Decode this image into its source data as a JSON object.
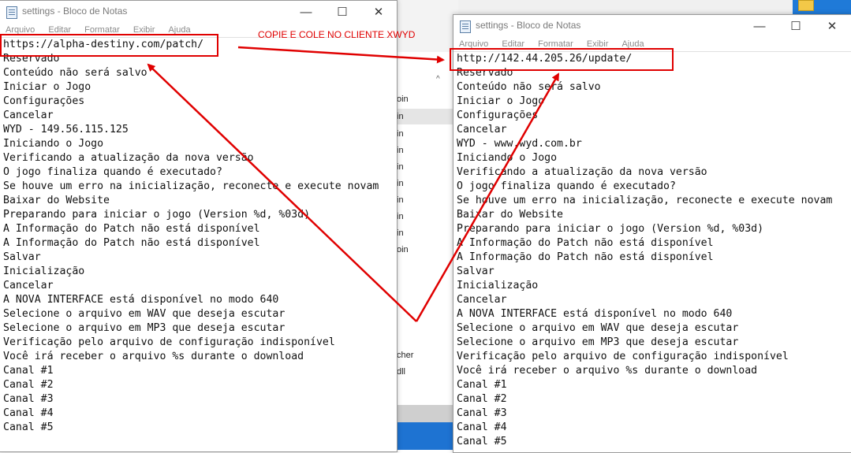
{
  "colors": {
    "annotation": "#e00000",
    "text": "#111111",
    "title_text": "#7a7a7a"
  },
  "background": {
    "explorer_rows": [
      "oin",
      "in",
      "in",
      "in",
      "in",
      "in",
      "in",
      "in",
      "in",
      "oin",
      "cher",
      "dll"
    ]
  },
  "annotation": {
    "label": "COPIE E COLE NO CLIENTE XWYD"
  },
  "left_window": {
    "title": "settings - Bloco de Notas",
    "menu": [
      "Arquivo",
      "Editar",
      "Formatar",
      "Exibir",
      "Ajuda"
    ],
    "buttons": {
      "minimize": "—",
      "maximize": "☐",
      "close": "✕"
    },
    "lines": [
      "https://alpha-destiny.com/patch/",
      "Reservado",
      "Conteúdo não será salvo",
      "Iniciar o Jogo",
      "Configurações",
      "Cancelar",
      "WYD - 149.56.115.125",
      "Iniciando o Jogo",
      "Verificando a atualização da nova versão",
      "O jogo finaliza quando é executado?",
      "Se houve um erro na inicialização, reconecte e execute novam",
      "Baixar do Website",
      "Preparando para iniciar o jogo (Version %d, %03d)",
      "A Informação do Patch não está disponível",
      "A Informação do Patch não está disponível",
      "Salvar",
      "Inicialização",
      "Cancelar",
      "A NOVA INTERFACE está disponível no modo 640",
      "Selecione o arquivo em WAV que deseja escutar",
      "Selecione o arquivo em MP3 que deseja escutar",
      "Verificação pelo arquivo de configuração indisponível",
      "Você irá receber o arquivo %s durante o download",
      "Canal #1",
      "Canal #2",
      "Canal #3",
      "Canal #4",
      "Canal #5"
    ]
  },
  "right_window": {
    "title": "settings - Bloco de Notas",
    "menu": [
      "Arquivo",
      "Editar",
      "Formatar",
      "Exibir",
      "Ajuda"
    ],
    "buttons": {
      "minimize": "—",
      "maximize": "☐",
      "close": "✕"
    },
    "lines": [
      "http://142.44.205.26/update/",
      "Reservado",
      "Conteúdo não será salvo",
      "Iniciar o Jogo",
      "Configurações",
      "Cancelar",
      "WYD - www.wyd.com.br",
      "Iniciando o Jogo",
      "Verificando a atualização da nova versão",
      "O jogo finaliza quando é executado?",
      "Se houve um erro na inicialização, reconecte e execute novam",
      "Baixar do Website",
      "Preparando para iniciar o jogo (Version %d, %03d)",
      "A Informação do Patch não está disponível",
      "A Informação do Patch não está disponível",
      "Salvar",
      "Inicialização",
      "Cancelar",
      "A NOVA INTERFACE está disponível no modo 640",
      "Selecione o arquivo em WAV que deseja escutar",
      "Selecione o arquivo em MP3 que deseja escutar",
      "Verificação pelo arquivo de configuração indisponível",
      "Você irá receber o arquivo %s durante o download",
      "Canal #1",
      "Canal #2",
      "Canal #3",
      "Canal #4",
      "Canal #5"
    ]
  }
}
